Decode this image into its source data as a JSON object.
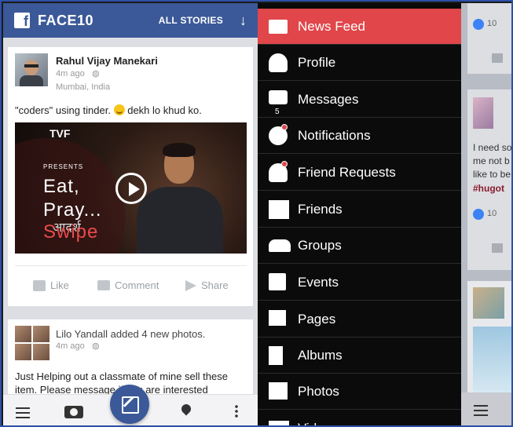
{
  "left_app": {
    "title": "FACE10",
    "all_stories": "ALL STORIES",
    "post1": {
      "name": "Rahul Vijay Manekari",
      "time": "4m ago",
      "location": "Mumbai, India",
      "text_before": "\"coders\" using tinder.",
      "text_after": "dekh lo khud ko.",
      "video": {
        "brand": "TVF",
        "presents": "PRESENTS",
        "line1": "Eat,",
        "line2": "Pray...",
        "line3": "Swipe",
        "shirt_text": "आदर्श"
      },
      "actions": {
        "like": "Like",
        "comment": "Comment",
        "share": "Share"
      }
    },
    "post2": {
      "header": "Lilo Yandall added 4 new photos.",
      "time": "4m ago",
      "text_line1": "Just Helping out a classmate of mine sell these",
      "text_line2": "item. Please message      if you are interested"
    }
  },
  "drawer": {
    "items": [
      {
        "label": "News Feed",
        "icon": "newspaper-icon"
      },
      {
        "label": "Profile",
        "icon": "person-icon"
      },
      {
        "label": "Messages",
        "icon": "chat-icon",
        "count": "5"
      },
      {
        "label": "Notifications",
        "icon": "globe-icon"
      },
      {
        "label": "Friend Requests",
        "icon": "friend-request-icon"
      },
      {
        "label": "Friends",
        "icon": "friends-icon"
      },
      {
        "label": "Groups",
        "icon": "groups-icon"
      },
      {
        "label": "Events",
        "icon": "calendar-icon"
      },
      {
        "label": "Pages",
        "icon": "flag-icon"
      },
      {
        "label": "Albums",
        "icon": "album-icon"
      },
      {
        "label": "Photos",
        "icon": "photo-icon"
      },
      {
        "label": "Videos",
        "icon": "video-icon"
      }
    ]
  },
  "peek": {
    "like_count_1": "10",
    "text1": "I need so",
    "text2": "me not b",
    "text3": "like to be",
    "hashtag": "#hugot",
    "like_count_2": "10"
  },
  "colors": {
    "brand": "#3b5998",
    "active": "#e0464a"
  }
}
